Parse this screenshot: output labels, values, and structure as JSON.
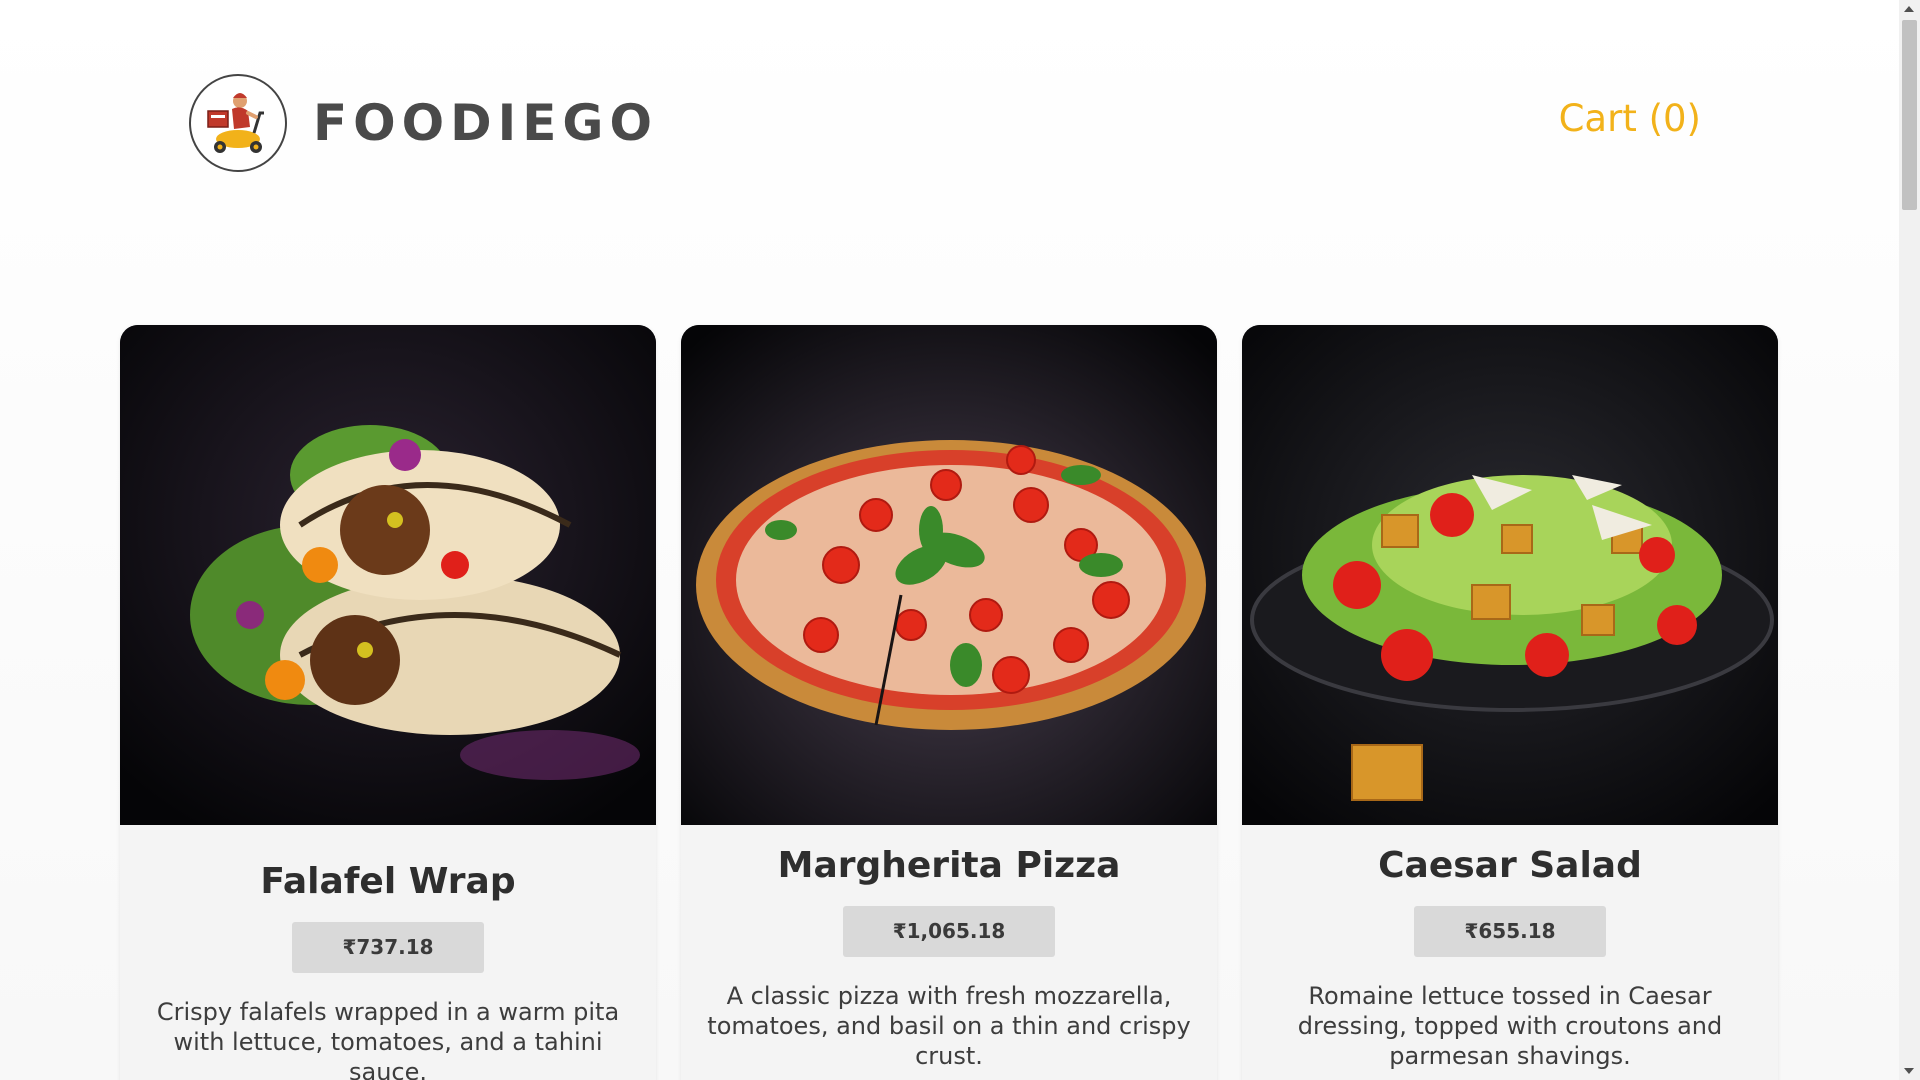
{
  "header": {
    "brand": "FOODIEGO",
    "logo_icon": "delivery-scooter-icon",
    "cart_label": "Cart (0)"
  },
  "colors": {
    "accent": "#f2b21a",
    "logo_red": "#c0392b",
    "logo_yellow": "#f2b21a"
  },
  "products": [
    {
      "name": "Falafel Wrap",
      "price": "₹737.18",
      "description": "Crispy falafels wrapped in a warm pita with lettuce, tomatoes, and a tahini sauce.",
      "image_icon": "falafel-wrap-image"
    },
    {
      "name": "Margherita Pizza",
      "price": "₹1,065.18",
      "description": "A classic pizza with fresh mozzarella, tomatoes, and basil on a thin and crispy crust.",
      "image_icon": "margherita-pizza-image"
    },
    {
      "name": "Caesar Salad",
      "price": "₹655.18",
      "description": "Romaine lettuce tossed in Caesar dressing, topped with croutons and parmesan shavings.",
      "image_icon": "caesar-salad-image"
    }
  ]
}
